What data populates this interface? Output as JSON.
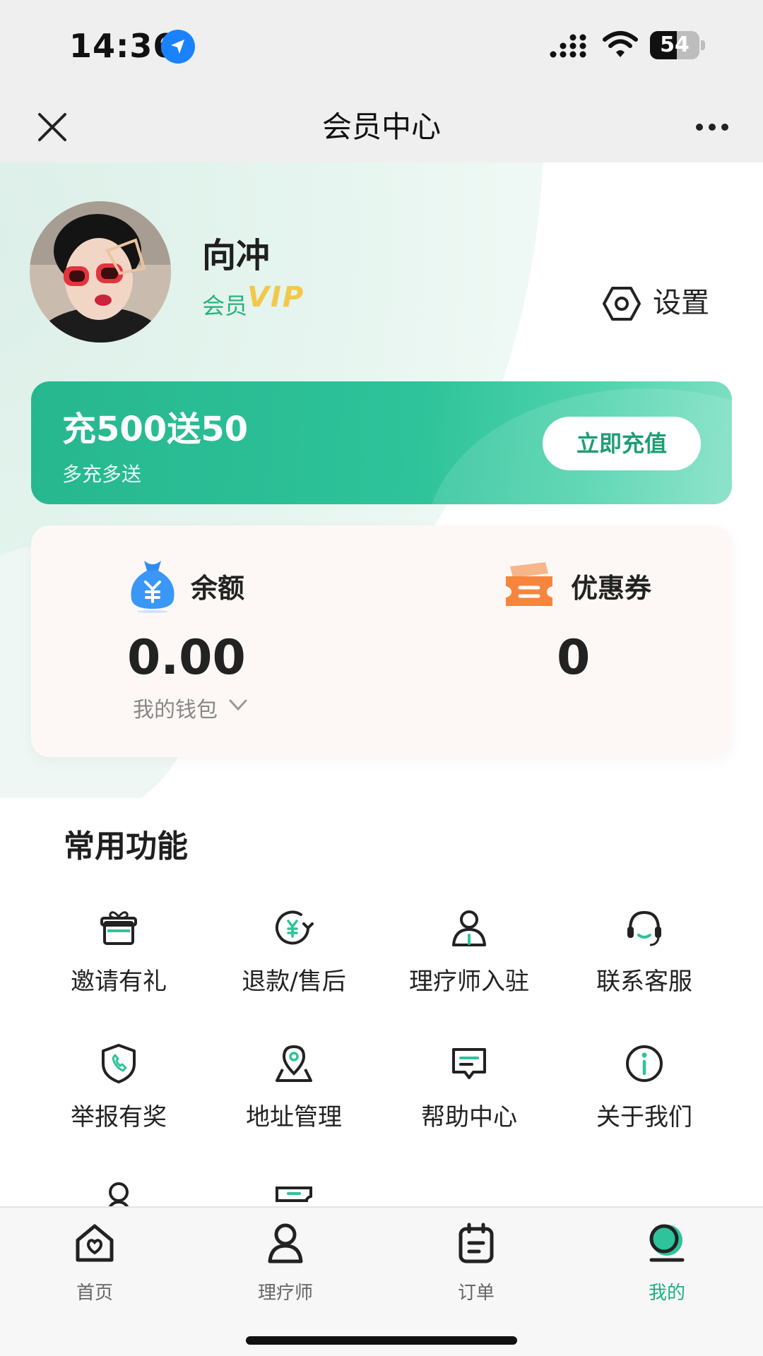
{
  "status_bar": {
    "time": "14:36",
    "battery": "54",
    "battery_level": 0.54
  },
  "nav": {
    "title": "会员中心"
  },
  "profile": {
    "name": "向冲",
    "member_label": "会员",
    "vip_label": "VIP",
    "settings_label": "设置"
  },
  "promo": {
    "title": "充500送50",
    "subtitle": "多充多送",
    "button": "立即充值"
  },
  "wallet": {
    "balance_label": "余额",
    "balance_value": "0.00",
    "wallet_link": "我的钱包",
    "coupon_label": "优惠券",
    "coupon_value": "0"
  },
  "functions": {
    "title": "常用功能",
    "items": [
      {
        "label": "邀请有礼",
        "icon": "gift-icon"
      },
      {
        "label": "退款/售后",
        "icon": "refund-icon"
      },
      {
        "label": "理疗师入驻",
        "icon": "therapist-icon"
      },
      {
        "label": "联系客服",
        "icon": "headset-icon"
      },
      {
        "label": "举报有奖",
        "icon": "shield-phone-icon"
      },
      {
        "label": "地址管理",
        "icon": "location-icon"
      },
      {
        "label": "帮助中心",
        "icon": "message-icon"
      },
      {
        "label": "关于我们",
        "icon": "info-icon"
      }
    ]
  },
  "tabbar": {
    "items": [
      {
        "label": "首页",
        "icon": "home-icon"
      },
      {
        "label": "理疗师",
        "icon": "person-icon"
      },
      {
        "label": "订单",
        "icon": "order-icon"
      },
      {
        "label": "我的",
        "icon": "profile-icon"
      }
    ],
    "active_color": "#1fae82"
  },
  "colors": {
    "accent": "#2ec39a",
    "vip": "#f2c84a",
    "location_badge": "#1a82ff"
  }
}
